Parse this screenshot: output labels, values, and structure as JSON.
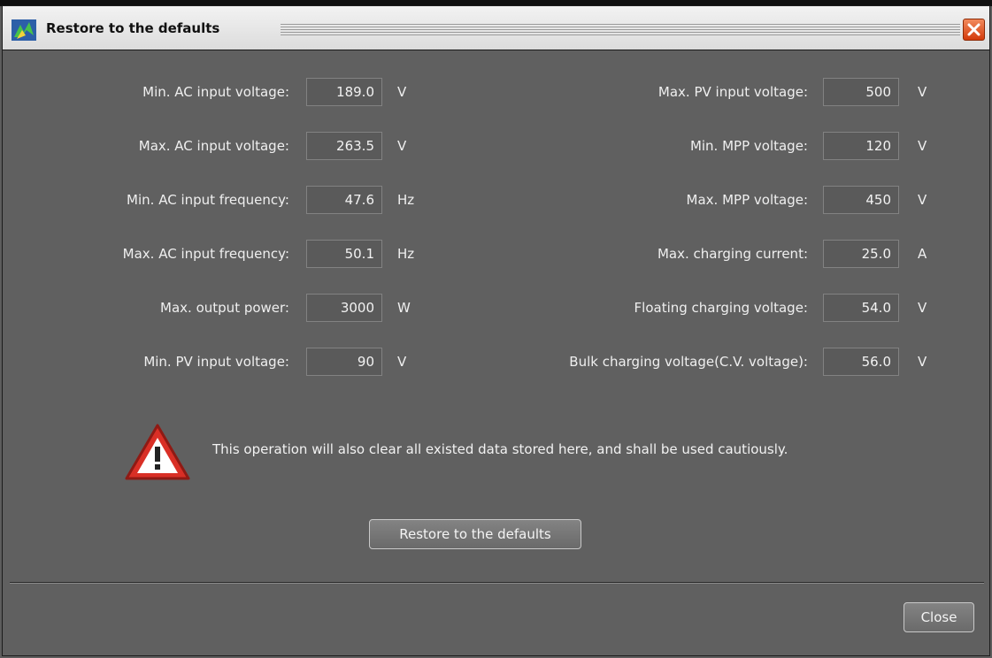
{
  "window": {
    "title": "Restore to the defaults",
    "accent": "#e2501a"
  },
  "left_fields": [
    {
      "label": "Min. AC input voltage:",
      "value": "189.0",
      "unit": "V"
    },
    {
      "label": "Max. AC input voltage:",
      "value": "263.5",
      "unit": "V"
    },
    {
      "label": "Min. AC input frequency:",
      "value": "47.6",
      "unit": "Hz"
    },
    {
      "label": "Max. AC input frequency:",
      "value": "50.1",
      "unit": "Hz"
    },
    {
      "label": "Max. output power:",
      "value": "3000",
      "unit": "W"
    },
    {
      "label": "Min. PV input voltage:",
      "value": "90",
      "unit": "V"
    }
  ],
  "right_fields": [
    {
      "label": "Max. PV input voltage:",
      "value": "500",
      "unit": "V"
    },
    {
      "label": "Min. MPP voltage:",
      "value": "120",
      "unit": "V"
    },
    {
      "label": "Max. MPP voltage:",
      "value": "450",
      "unit": "V"
    },
    {
      "label": "Max. charging current:",
      "value": "25.0",
      "unit": "A"
    },
    {
      "label": "Floating charging voltage:",
      "value": "54.0",
      "unit": "V"
    },
    {
      "label": "Bulk charging voltage(C.V. voltage):",
      "value": "56.0",
      "unit": "V"
    }
  ],
  "warning": {
    "icon": "warning-triangle-icon",
    "text": "This operation will also clear all existed data stored here, and shall be used cautiously."
  },
  "buttons": {
    "restore": "Restore to the defaults",
    "close": "Close"
  }
}
